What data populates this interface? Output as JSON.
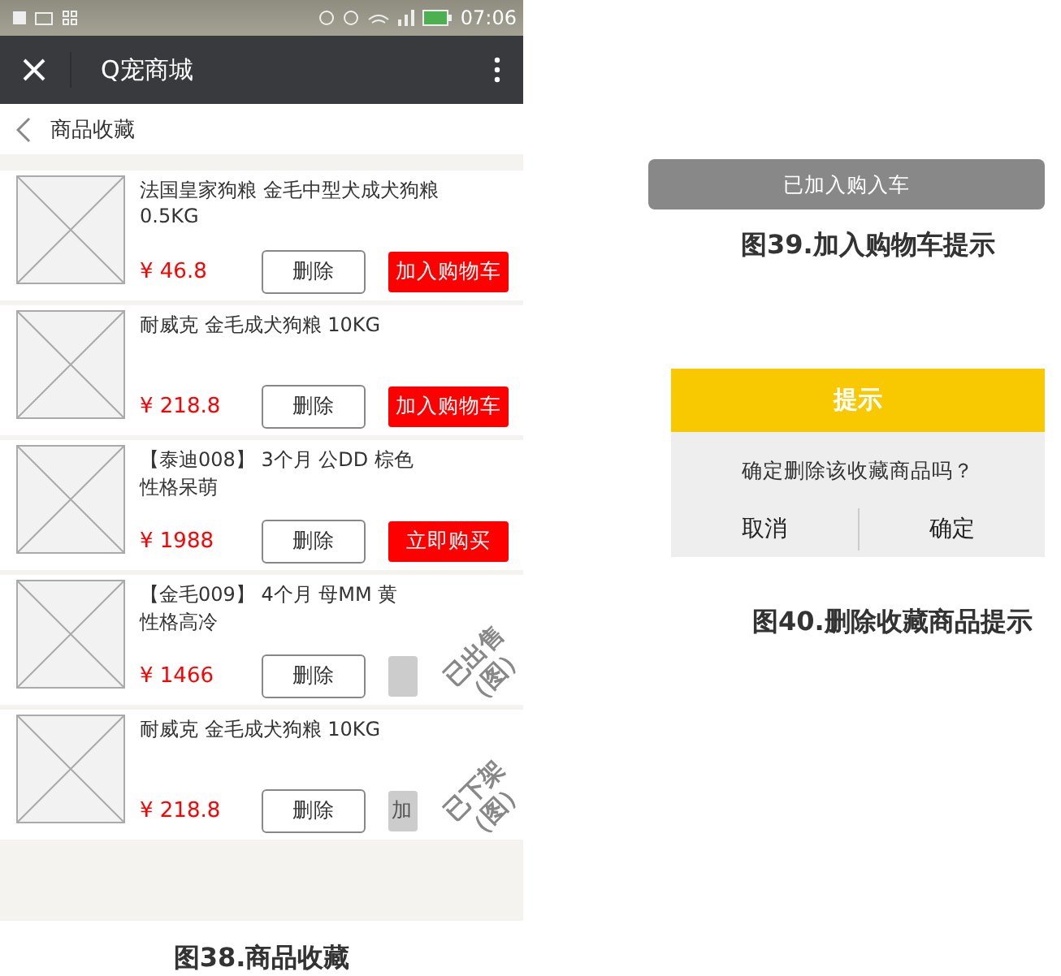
{
  "phone": {
    "status_bar": {
      "time": "07:06"
    },
    "app_bar": {
      "title": "Q宠商城"
    },
    "page_header": {
      "title": "商品收藏"
    },
    "items": [
      {
        "title": "法国皇家狗粮 金毛中型犬成犬狗粮 0.5KG",
        "price": "¥ 46.8",
        "delete": "删除",
        "action": {
          "label": "加入购物车",
          "disabled": false
        }
      },
      {
        "title": "耐威克 金毛成犬狗粮 10KG",
        "price": "¥ 218.8",
        "delete": "删除",
        "action": {
          "label": "加入购物车",
          "disabled": false
        }
      },
      {
        "title": "【泰迪008】 3个月 公DD 棕色",
        "subtitle": "性格呆萌",
        "price": "¥ 1988",
        "delete": "删除",
        "action": {
          "label": "立即购买",
          "disabled": false
        }
      },
      {
        "title": "【金毛009】 4个月 母MM 黄",
        "subtitle": "性格高冷",
        "price": "¥ 1466",
        "delete": "删除",
        "action": {
          "disabled": true
        },
        "stamp": {
          "text": "已出售",
          "sub": "（图）"
        }
      },
      {
        "title": "耐威克 金毛成犬狗粮 10KG",
        "price": "¥ 218.8",
        "delete": "删除",
        "action": {
          "label": "加",
          "disabled": true
        },
        "stamp": {
          "text": "已下架",
          "sub": "（图）"
        }
      }
    ],
    "caption": "图38.商品收藏"
  },
  "toast": {
    "text": "已加入购入车",
    "caption": "图39.加入购物车提示"
  },
  "dialog": {
    "title": "提示",
    "message": "确定删除该收藏商品吗？",
    "buttons": [
      "取消",
      "确定"
    ],
    "caption": "图40.删除收藏商品提示"
  }
}
